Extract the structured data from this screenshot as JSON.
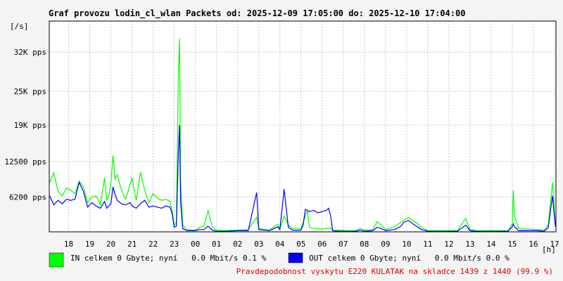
{
  "chart_data": {
    "type": "line",
    "title": "Graf provozu lodin_cl_wlan Packets od: 2025-12-09 17:05:00 do: 2025-12-10 17:04:00",
    "y_unit_label": "[/s]",
    "x_unit_label": "[h]",
    "y_ticks": [
      {
        "value": 6200,
        "label": "6200 pps"
      },
      {
        "value": 12500,
        "label": "12500 pps"
      },
      {
        "value": 19000,
        "label": "19K pps"
      },
      {
        "value": 25000,
        "label": "25K pps"
      },
      {
        "value": 32000,
        "label": "32K pps"
      }
    ],
    "ylim": [
      0,
      37500
    ],
    "xlim": [
      17.083,
      41.067
    ],
    "x_ticks": [
      {
        "value": 18,
        "label": "18"
      },
      {
        "value": 19,
        "label": "19"
      },
      {
        "value": 20,
        "label": "20"
      },
      {
        "value": 21,
        "label": "21"
      },
      {
        "value": 22,
        "label": "22"
      },
      {
        "value": 23,
        "label": "23"
      },
      {
        "value": 24,
        "label": "00"
      },
      {
        "value": 25,
        "label": "01"
      },
      {
        "value": 26,
        "label": "02"
      },
      {
        "value": 27,
        "label": "03"
      },
      {
        "value": 28,
        "label": "04"
      },
      {
        "value": 29,
        "label": "05"
      },
      {
        "value": 30,
        "label": "06"
      },
      {
        "value": 31,
        "label": "07"
      },
      {
        "value": 32,
        "label": "08"
      },
      {
        "value": 33,
        "label": "09"
      },
      {
        "value": 34,
        "label": "10"
      },
      {
        "value": 35,
        "label": "11"
      },
      {
        "value": 36,
        "label": "12"
      },
      {
        "value": 37,
        "label": "13"
      },
      {
        "value": 38,
        "label": "14"
      },
      {
        "value": 39,
        "label": "15"
      },
      {
        "value": 40,
        "label": "16"
      },
      {
        "value": 41,
        "label": "17"
      }
    ],
    "grid": true,
    "series": [
      {
        "name": "IN",
        "color": "#00ff00",
        "legend_text": "IN celkem 0 Gbyte; nyní   0.0 Mbit/s 0.1 %",
        "points": [
          [
            17.1,
            8800
          ],
          [
            17.3,
            10500
          ],
          [
            17.5,
            7200
          ],
          [
            17.7,
            6400
          ],
          [
            17.9,
            7800
          ],
          [
            18.1,
            7400
          ],
          [
            18.3,
            6800
          ],
          [
            18.5,
            9000
          ],
          [
            18.7,
            8000
          ],
          [
            18.9,
            5200
          ],
          [
            19.1,
            6200
          ],
          [
            19.3,
            6400
          ],
          [
            19.5,
            4800
          ],
          [
            19.7,
            9600
          ],
          [
            19.8,
            5600
          ],
          [
            19.9,
            6400
          ],
          [
            20.0,
            8600
          ],
          [
            20.1,
            13600
          ],
          [
            20.2,
            9400
          ],
          [
            20.3,
            10200
          ],
          [
            20.5,
            7400
          ],
          [
            20.7,
            5800
          ],
          [
            20.9,
            8400
          ],
          [
            21.0,
            9600
          ],
          [
            21.2,
            5600
          ],
          [
            21.4,
            10600
          ],
          [
            21.6,
            7400
          ],
          [
            21.8,
            5200
          ],
          [
            22.0,
            6800
          ],
          [
            22.2,
            6000
          ],
          [
            22.4,
            5600
          ],
          [
            22.6,
            5800
          ],
          [
            22.8,
            5400
          ],
          [
            22.9,
            3800
          ],
          [
            23.0,
            1200
          ],
          [
            23.1,
            1600
          ],
          [
            23.2,
            29000
          ],
          [
            23.25,
            34400
          ],
          [
            23.3,
            9000
          ],
          [
            23.4,
            1200
          ],
          [
            23.6,
            400
          ],
          [
            24.0,
            300
          ],
          [
            24.2,
            800
          ],
          [
            24.4,
            1000
          ],
          [
            24.6,
            3800
          ],
          [
            24.8,
            800
          ],
          [
            25.0,
            300
          ],
          [
            25.4,
            200
          ],
          [
            26.0,
            300
          ],
          [
            26.5,
            400
          ],
          [
            26.9,
            2600
          ],
          [
            27.0,
            600
          ],
          [
            27.5,
            300
          ],
          [
            27.9,
            1400
          ],
          [
            28.0,
            500
          ],
          [
            28.2,
            2800
          ],
          [
            28.4,
            1200
          ],
          [
            28.6,
            600
          ],
          [
            29.0,
            600
          ],
          [
            29.3,
            3800
          ],
          [
            29.4,
            800
          ],
          [
            29.6,
            600
          ],
          [
            30.0,
            500
          ],
          [
            30.4,
            700
          ],
          [
            30.5,
            200
          ],
          [
            30.8,
            300
          ],
          [
            31.2,
            200
          ],
          [
            31.6,
            200
          ],
          [
            31.8,
            600
          ],
          [
            32.0,
            300
          ],
          [
            32.4,
            400
          ],
          [
            32.6,
            1800
          ],
          [
            32.8,
            1200
          ],
          [
            33.0,
            400
          ],
          [
            33.4,
            900
          ],
          [
            33.7,
            1600
          ],
          [
            33.9,
            2200
          ],
          [
            34.1,
            2500
          ],
          [
            34.3,
            2000
          ],
          [
            34.5,
            1500
          ],
          [
            34.7,
            800
          ],
          [
            35.0,
            200
          ],
          [
            35.5,
            200
          ],
          [
            36.0,
            200
          ],
          [
            36.4,
            200
          ],
          [
            36.8,
            2400
          ],
          [
            37.0,
            400
          ],
          [
            37.3,
            200
          ],
          [
            37.8,
            200
          ],
          [
            38.3,
            200
          ],
          [
            38.8,
            200
          ],
          [
            39.0,
            1400
          ],
          [
            39.05,
            7400
          ],
          [
            39.1,
            2800
          ],
          [
            39.3,
            600
          ],
          [
            39.5,
            500
          ],
          [
            39.8,
            500
          ],
          [
            40.2,
            400
          ],
          [
            40.5,
            300
          ],
          [
            40.7,
            1200
          ],
          [
            40.9,
            8800
          ],
          [
            41.0,
            3500
          ],
          [
            41.05,
            1200
          ]
        ]
      },
      {
        "name": "OUT",
        "color": "#0000ff",
        "legend_text": "OUT celkem 0 Gbyte; nyní   0.0 Mbit/s 0.0 %",
        "points": [
          [
            17.1,
            6400
          ],
          [
            17.3,
            4800
          ],
          [
            17.5,
            5600
          ],
          [
            17.7,
            5000
          ],
          [
            17.9,
            5800
          ],
          [
            18.1,
            5600
          ],
          [
            18.3,
            5800
          ],
          [
            18.5,
            8800
          ],
          [
            18.7,
            7200
          ],
          [
            18.9,
            4400
          ],
          [
            19.1,
            5200
          ],
          [
            19.3,
            4600
          ],
          [
            19.5,
            4200
          ],
          [
            19.7,
            5400
          ],
          [
            19.8,
            4200
          ],
          [
            19.9,
            4600
          ],
          [
            20.0,
            5000
          ],
          [
            20.1,
            8000
          ],
          [
            20.2,
            6600
          ],
          [
            20.3,
            5600
          ],
          [
            20.5,
            5000
          ],
          [
            20.7,
            4800
          ],
          [
            20.9,
            5200
          ],
          [
            21.0,
            4600
          ],
          [
            21.2,
            4200
          ],
          [
            21.4,
            5000
          ],
          [
            21.6,
            5600
          ],
          [
            21.8,
            4400
          ],
          [
            22.0,
            4600
          ],
          [
            22.2,
            4400
          ],
          [
            22.4,
            4200
          ],
          [
            22.6,
            4600
          ],
          [
            22.8,
            4400
          ],
          [
            22.9,
            3200
          ],
          [
            23.0,
            800
          ],
          [
            23.1,
            1000
          ],
          [
            23.2,
            14600
          ],
          [
            23.25,
            19000
          ],
          [
            23.3,
            5400
          ],
          [
            23.4,
            600
          ],
          [
            23.6,
            200
          ],
          [
            24.0,
            200
          ],
          [
            24.2,
            400
          ],
          [
            24.4,
            400
          ],
          [
            24.6,
            1000
          ],
          [
            24.8,
            300
          ],
          [
            25.0,
            100
          ],
          [
            25.4,
            100
          ],
          [
            26.0,
            200
          ],
          [
            26.5,
            200
          ],
          [
            26.9,
            7000
          ],
          [
            27.0,
            400
          ],
          [
            27.5,
            200
          ],
          [
            27.9,
            900
          ],
          [
            28.0,
            400
          ],
          [
            28.2,
            7600
          ],
          [
            28.4,
            800
          ],
          [
            28.6,
            300
          ],
          [
            29.0,
            300
          ],
          [
            29.1,
            1200
          ],
          [
            29.2,
            4000
          ],
          [
            29.4,
            3600
          ],
          [
            29.6,
            3800
          ],
          [
            29.8,
            3400
          ],
          [
            30.0,
            3600
          ],
          [
            30.2,
            3800
          ],
          [
            30.3,
            4200
          ],
          [
            30.4,
            2800
          ],
          [
            30.5,
            200
          ],
          [
            30.8,
            100
          ],
          [
            31.2,
            100
          ],
          [
            31.6,
            100
          ],
          [
            31.8,
            300
          ],
          [
            32.0,
            100
          ],
          [
            32.4,
            200
          ],
          [
            32.6,
            800
          ],
          [
            32.8,
            600
          ],
          [
            33.0,
            200
          ],
          [
            33.4,
            400
          ],
          [
            33.7,
            900
          ],
          [
            33.9,
            1800
          ],
          [
            34.1,
            2000
          ],
          [
            34.3,
            1400
          ],
          [
            34.5,
            900
          ],
          [
            34.7,
            400
          ],
          [
            35.0,
            100
          ],
          [
            35.5,
            100
          ],
          [
            36.0,
            100
          ],
          [
            36.4,
            100
          ],
          [
            36.8,
            1200
          ],
          [
            37.0,
            200
          ],
          [
            37.3,
            100
          ],
          [
            37.8,
            100
          ],
          [
            38.3,
            100
          ],
          [
            38.8,
            100
          ],
          [
            39.0,
            900
          ],
          [
            39.05,
            1400
          ],
          [
            39.1,
            900
          ],
          [
            39.3,
            200
          ],
          [
            39.5,
            200
          ],
          [
            39.8,
            200
          ],
          [
            40.2,
            200
          ],
          [
            40.5,
            100
          ],
          [
            40.7,
            700
          ],
          [
            40.9,
            6400
          ],
          [
            41.0,
            2400
          ],
          [
            41.05,
            900
          ]
        ]
      }
    ],
    "footer": "Pravdepodobnost vyskytu E220 KULATAK na skladce 1439 z 1440 (99.9 %)"
  }
}
